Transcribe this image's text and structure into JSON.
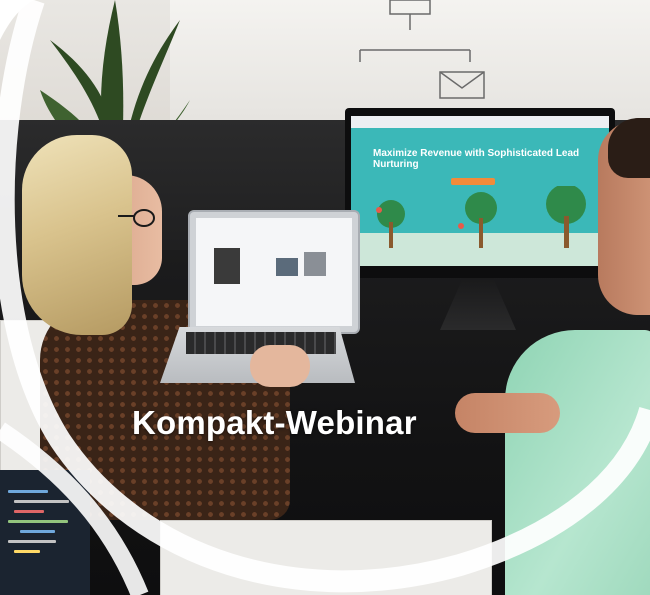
{
  "banner": {
    "title": "Kompakt-Webinar"
  },
  "monitor": {
    "headline": "Maximize Revenue with Sophisticated Lead Nurturing"
  },
  "colors": {
    "title_text": "#ffffff",
    "arc_white": "#ffffff",
    "shirt_mint": "#a8dfc4",
    "monitor_teal": "#3bb8b8"
  }
}
